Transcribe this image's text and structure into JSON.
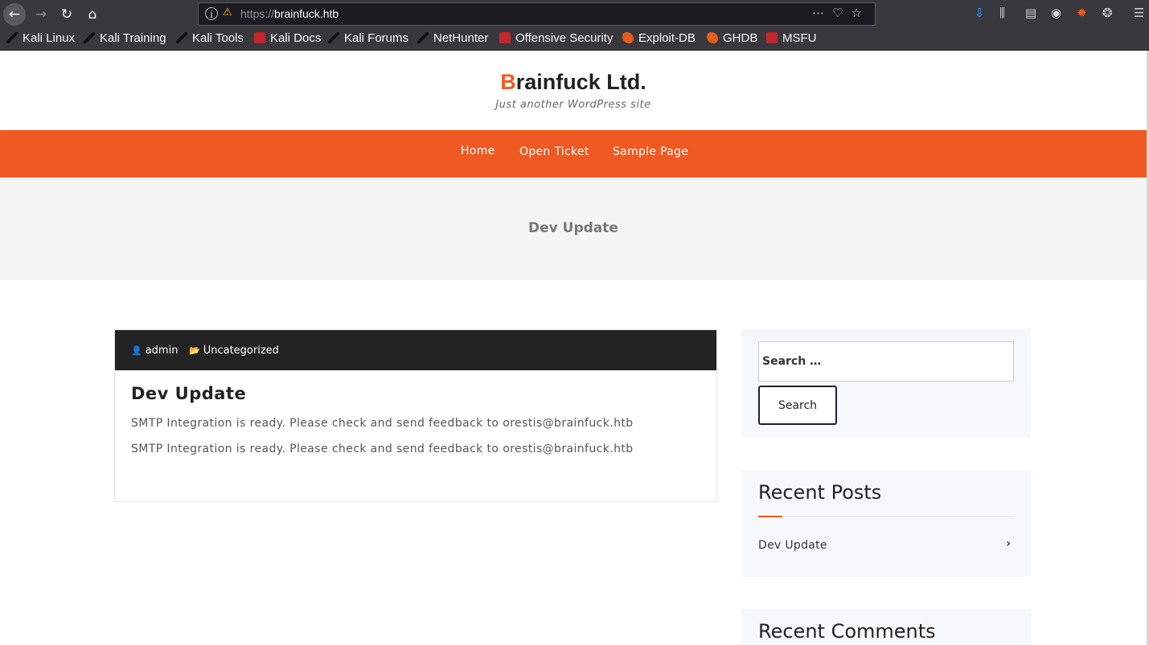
{
  "browser": {
    "url_scheme": "https://",
    "url_host": "brainfuck.htb",
    "bookmarks": [
      "Kali Linux",
      "Kali Training",
      "Kali Tools",
      "Kali Docs",
      "Kali Forums",
      "NetHunter",
      "Offensive Security",
      "Exploit-DB",
      "GHDB",
      "MSFU"
    ]
  },
  "site": {
    "title_first": "B",
    "title_rest": "rainfuck Ltd.",
    "description": "Just another WordPress site",
    "accent_color": "#f05a22"
  },
  "menu": [
    "Home",
    "Open Ticket",
    "Sample Page"
  ],
  "banner": {
    "title": "Dev Update"
  },
  "post": {
    "author": "admin",
    "category": "Uncategorized",
    "title": "Dev Update",
    "paragraphs": [
      "SMTP Integration is ready. Please check and send feedback to orestis@brainfuck.htb",
      "SMTP Integration is ready. Please check and send feedback to orestis@brainfuck.htb"
    ]
  },
  "sidebar": {
    "search_placeholder": "Search …",
    "search_button": "Search",
    "recent_posts_title": "Recent Posts",
    "recent_posts": [
      "Dev Update"
    ],
    "recent_comments_title": "Recent Comments"
  }
}
